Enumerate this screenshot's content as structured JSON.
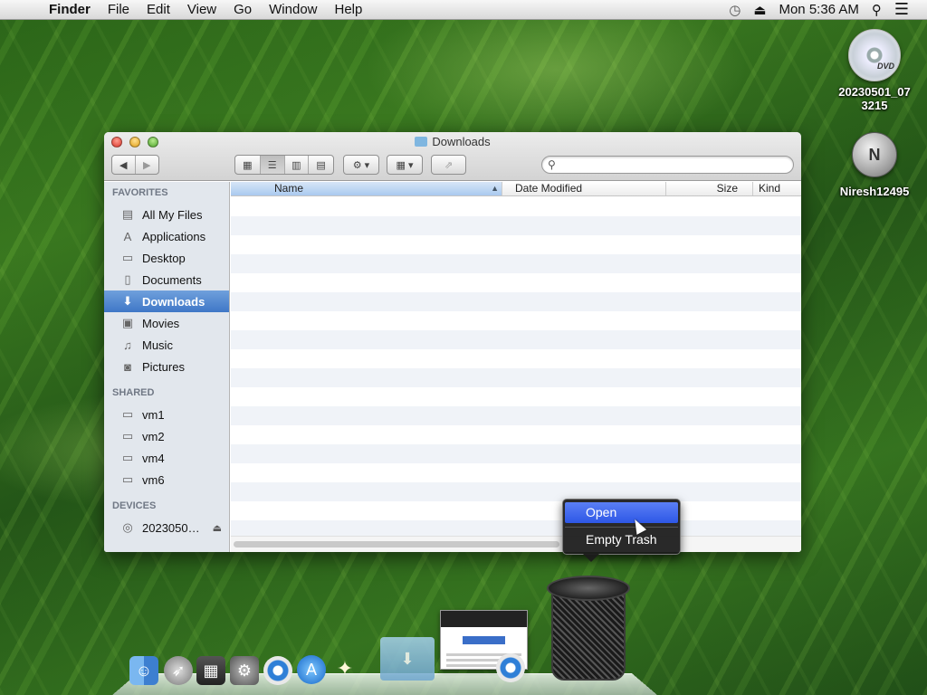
{
  "menubar": {
    "apple_icon": "apple-icon",
    "app_name": "Finder",
    "items": [
      "File",
      "Edit",
      "View",
      "Go",
      "Window",
      "Help"
    ],
    "clock": "Mon 5:36 AM"
  },
  "desktop": {
    "icons": [
      {
        "label_line1": "20230501_07",
        "label_line2": "3215",
        "disc_text": "DVD"
      },
      {
        "label": "Niresh12495",
        "glyph": "N"
      }
    ]
  },
  "finder": {
    "title": "Downloads",
    "search": {
      "value": "",
      "placeholder": ""
    },
    "sidebar": {
      "favorites_header": "FAVORITES",
      "favorites": [
        {
          "label": "All My Files",
          "icon": "all-files-icon"
        },
        {
          "label": "Applications",
          "icon": "applications-icon"
        },
        {
          "label": "Desktop",
          "icon": "desktop-icon"
        },
        {
          "label": "Documents",
          "icon": "documents-icon"
        },
        {
          "label": "Downloads",
          "icon": "downloads-icon",
          "selected": true
        },
        {
          "label": "Movies",
          "icon": "movies-icon"
        },
        {
          "label": "Music",
          "icon": "music-icon"
        },
        {
          "label": "Pictures",
          "icon": "pictures-icon"
        }
      ],
      "shared_header": "SHARED",
      "shared": [
        "vm1",
        "vm2",
        "vm4",
        "vm6"
      ],
      "devices_header": "DEVICES",
      "devices": [
        {
          "label": "2023050…",
          "icon": "disc-icon"
        }
      ]
    },
    "columns": {
      "name": "Name",
      "date": "Date Modified",
      "size": "Size",
      "kind": "Kind"
    }
  },
  "context_menu": {
    "items": [
      "Open",
      "Empty Trash"
    ],
    "highlighted": "Open"
  },
  "colors": {
    "selection_blue": "#3f77c7",
    "menu_highlight": "#2e57e6",
    "sidebar_bg": "#e2e7ed"
  }
}
